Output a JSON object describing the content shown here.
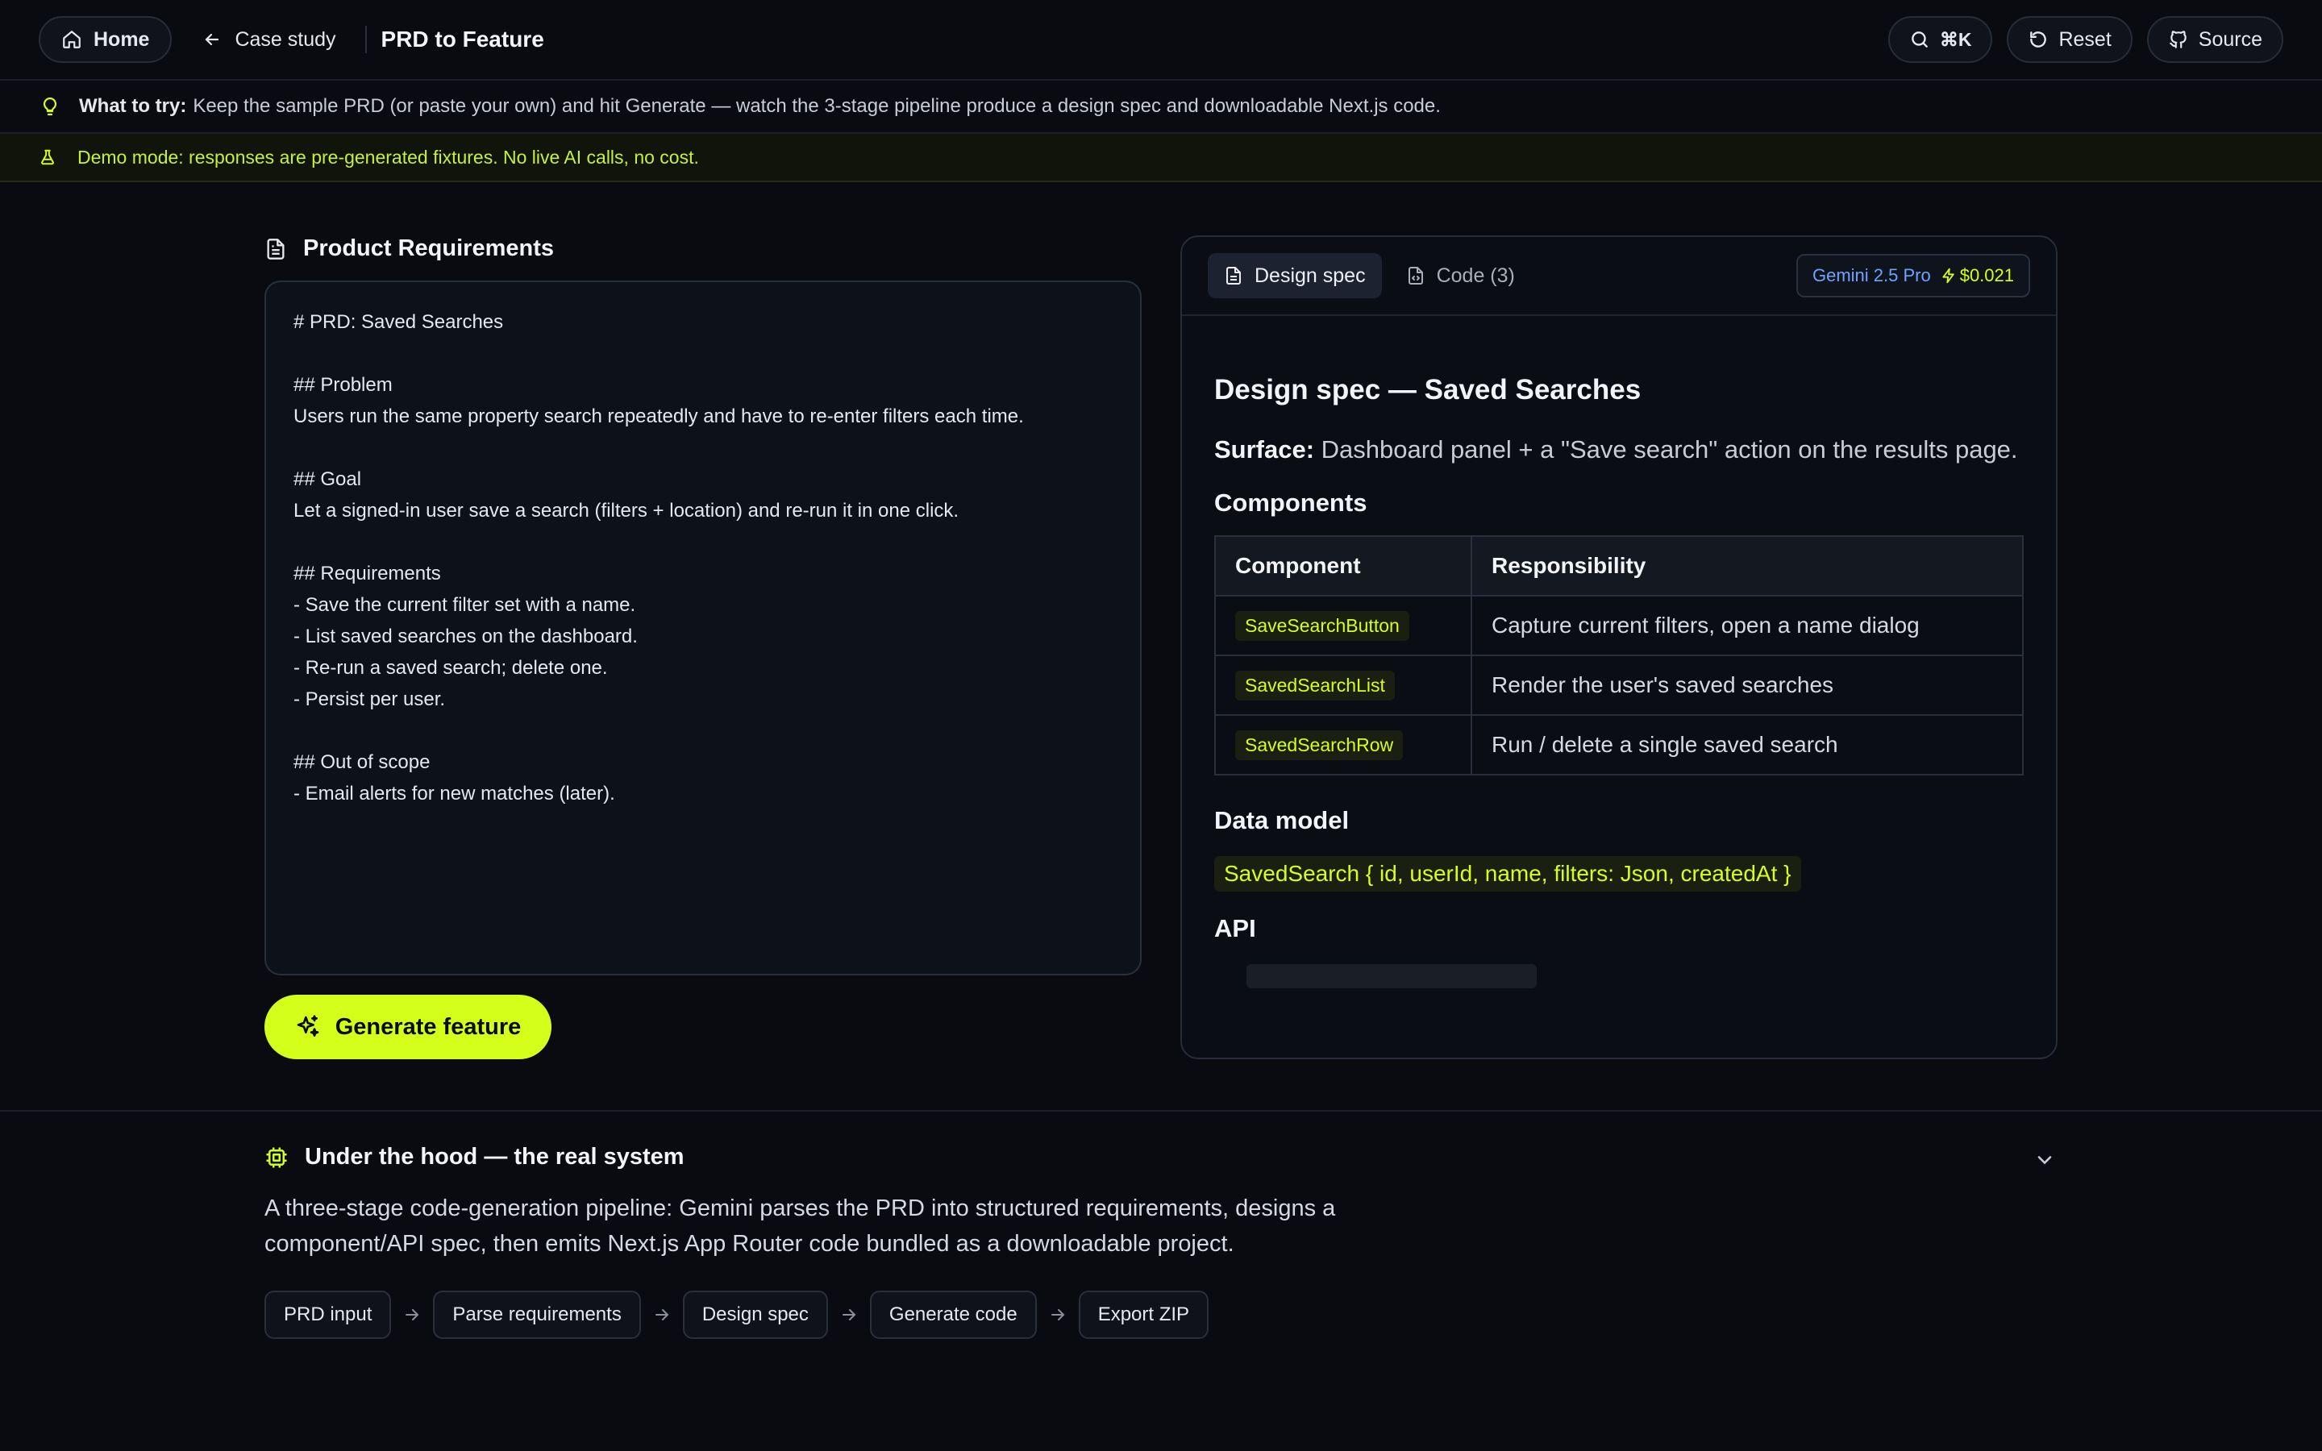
{
  "topbar": {
    "home_label": "Home",
    "back_label": "Case study",
    "title": "PRD to Feature",
    "search_shortcut": "⌘K",
    "reset_label": "Reset",
    "source_label": "Source"
  },
  "tip": {
    "label": "What to try:",
    "text": "Keep the sample PRD (or paste your own) and hit Generate — watch the 3-stage pipeline produce a design spec and downloadable Next.js code."
  },
  "demo_banner": "Demo mode: responses are pre-generated fixtures. No live AI calls, no cost.",
  "prd": {
    "heading": "Product Requirements",
    "text": "# PRD: Saved Searches\n\n## Problem\nUsers run the same property search repeatedly and have to re-enter filters each time.\n\n## Goal\nLet a signed-in user save a search (filters + location) and re-run it in one click.\n\n## Requirements\n- Save the current filter set with a name.\n- List saved searches on the dashboard.\n- Re-run a saved search; delete one.\n- Persist per user.\n\n## Out of scope\n- Email alerts for new matches (later).",
    "generate_label": "Generate feature"
  },
  "output": {
    "tabs": [
      {
        "label": "Design spec"
      },
      {
        "label": "Code (3)"
      }
    ],
    "model": "Gemini 2.5 Pro",
    "cost": "$0.021",
    "spec": {
      "title": "Design spec — Saved Searches",
      "surface_label": "Surface:",
      "surface_text": "Dashboard panel + a \"Save search\" action on the results page.",
      "components_heading": "Components",
      "table_headers": [
        "Component",
        "Responsibility"
      ],
      "rows": [
        {
          "component": "SaveSearchButton",
          "responsibility": "Capture current filters, open a name dialog"
        },
        {
          "component": "SavedSearchList",
          "responsibility": "Render the user's saved searches"
        },
        {
          "component": "SavedSearchRow",
          "responsibility": "Run / delete a single saved search"
        }
      ],
      "data_model_heading": "Data model",
      "data_model": "SavedSearch { id, userId, name, filters: Json, createdAt }",
      "api_heading": "API"
    }
  },
  "hood": {
    "heading": "Under the hood — the real system",
    "description": "A three-stage code-generation pipeline: Gemini parses the PRD into structured requirements, designs a component/API spec, then emits Next.js App Router code bundled as a downloadable project.",
    "stages": [
      "PRD input",
      "Parse requirements",
      "Design spec",
      "Generate code",
      "Export ZIP"
    ]
  },
  "colors": {
    "background": "#090b10",
    "accent": "#d4ff1a",
    "model_blue": "#6ea3ff"
  },
  "icons": [
    "home-icon",
    "arrow-left-icon",
    "search-icon",
    "reset-icon",
    "github-icon",
    "lightbulb-icon",
    "flask-icon",
    "document-icon",
    "sparkles-icon",
    "file-code-icon",
    "bolt-icon",
    "chip-icon",
    "chevron-down-icon",
    "arrow-right-icon"
  ]
}
